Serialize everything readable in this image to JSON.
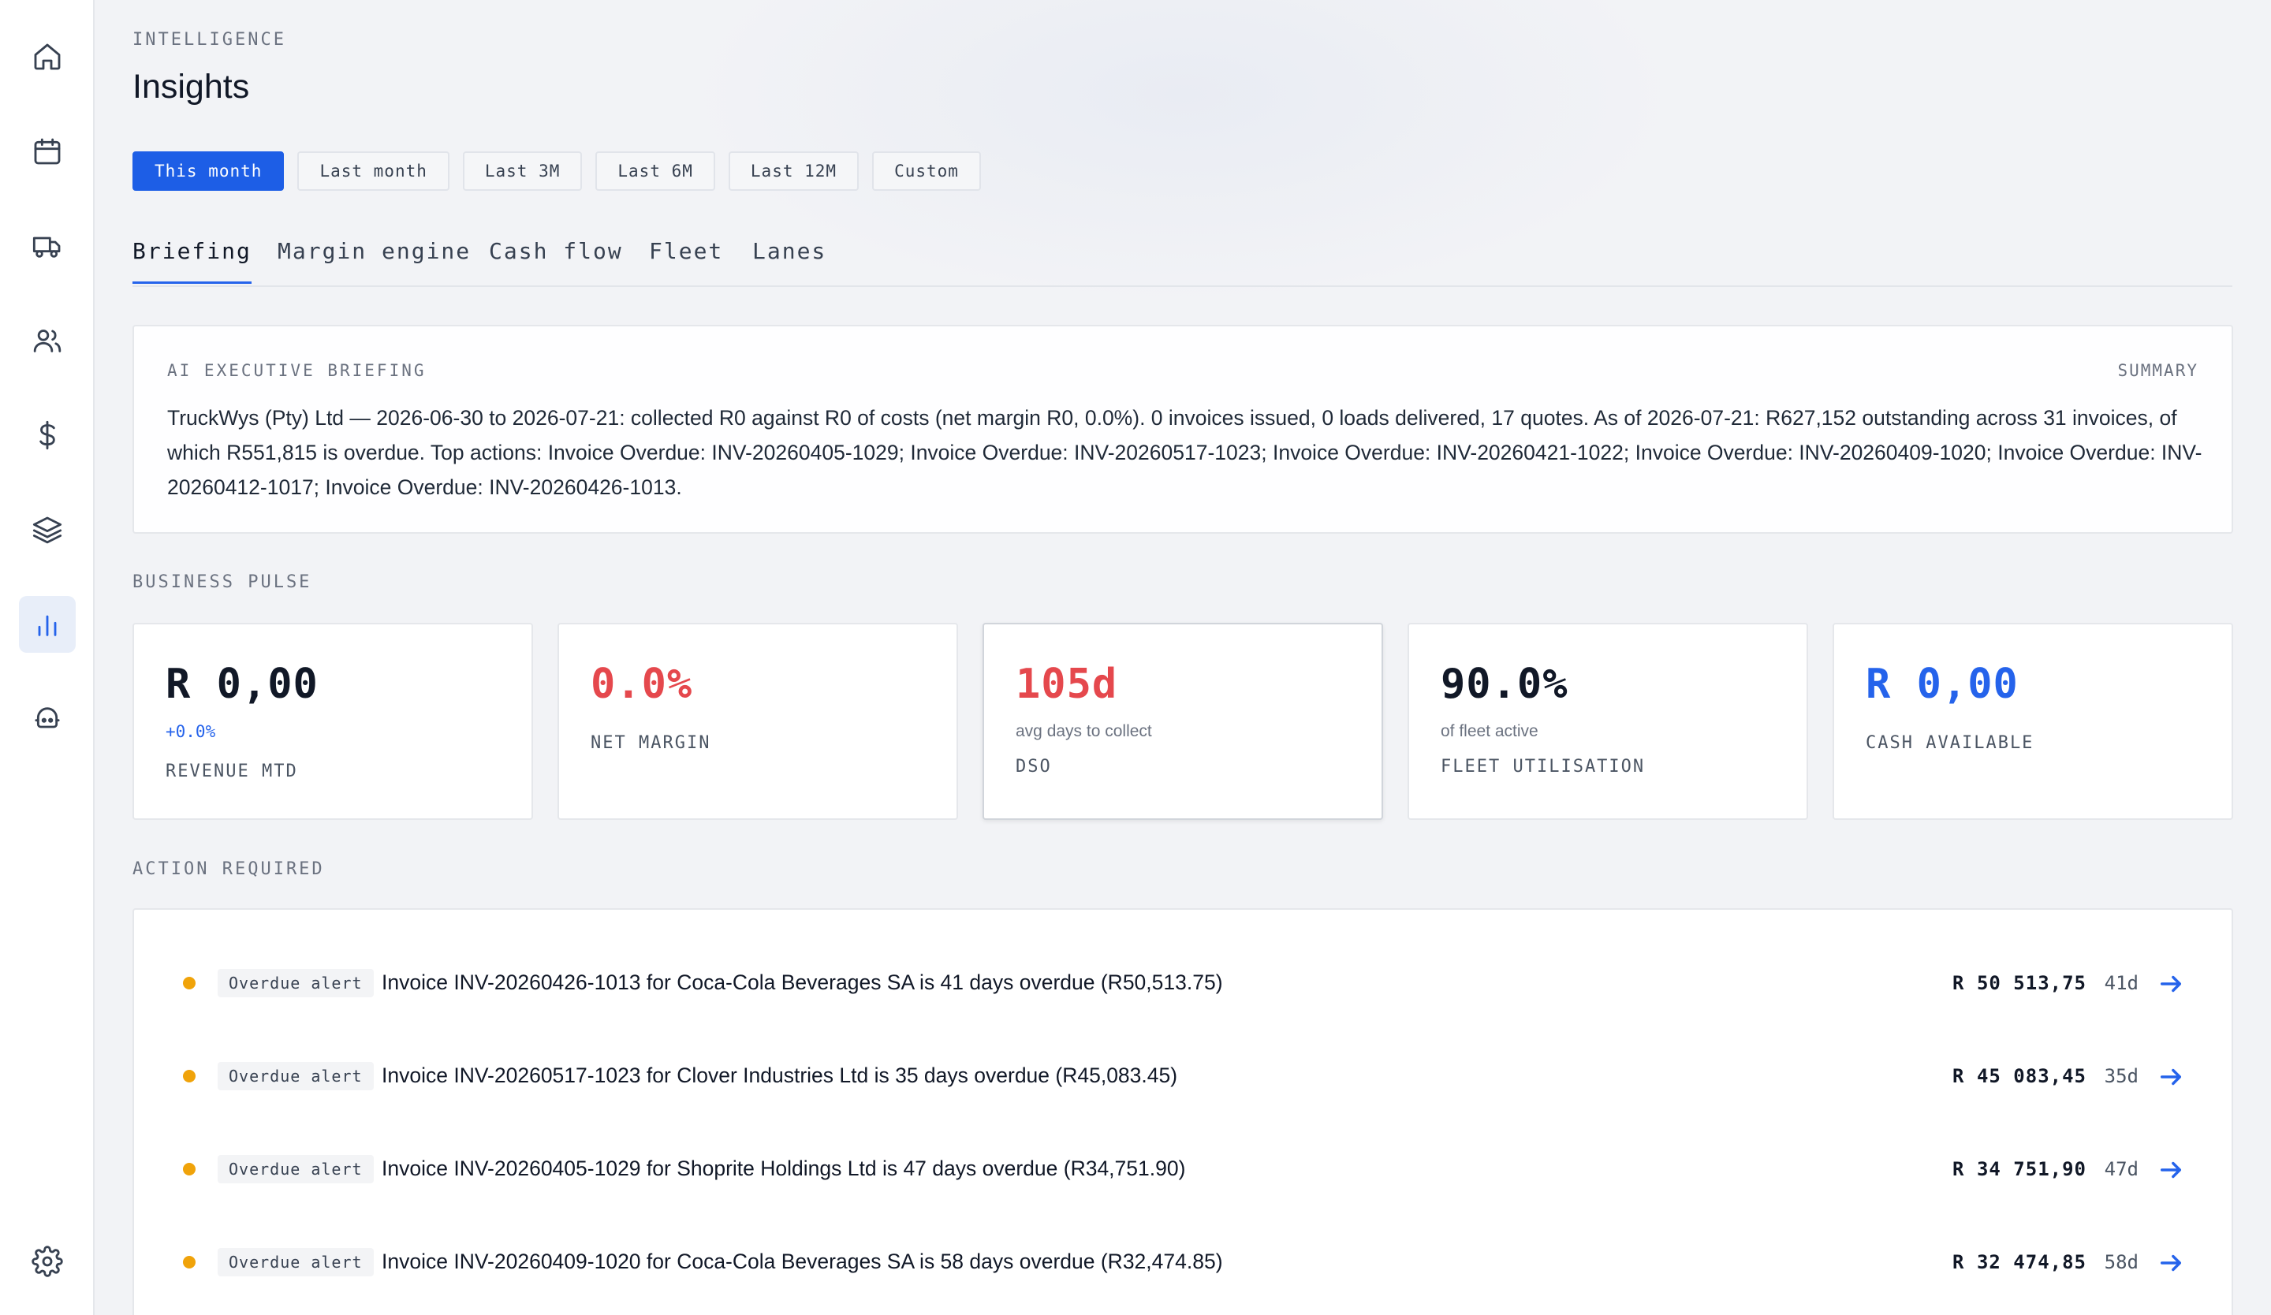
{
  "sidebar": {
    "items": [
      {
        "icon": "home-icon"
      },
      {
        "icon": "calendar-icon"
      },
      {
        "icon": "truck-icon"
      },
      {
        "icon": "users-icon"
      },
      {
        "icon": "dollar-icon"
      },
      {
        "icon": "layers-icon"
      },
      {
        "icon": "bar-chart-icon",
        "active": true
      },
      {
        "icon": "bot-icon"
      },
      {
        "icon": "settings-icon"
      }
    ]
  },
  "header": {
    "eyebrow": "INTELLIGENCE",
    "title": "Insights"
  },
  "date_ranges": [
    "This month",
    "Last month",
    "Last 3M",
    "Last 6M",
    "Last 12M",
    "Custom"
  ],
  "selected_range": "This month",
  "tabs": [
    "Briefing",
    "Margin engine",
    "Cash flow",
    "Fleet",
    "Lanes"
  ],
  "active_tab": "Briefing",
  "briefing": {
    "label": "AI EXECUTIVE BRIEFING",
    "tag": "SUMMARY",
    "text": "TruckWys (Pty) Ltd — 2026-06-30 to 2026-07-21: collected R0 against R0 of costs (net margin R0, 0.0%). 0 invoices issued, 0 loads delivered, 17 quotes. As of 2026-07-21: R627,152 outstanding across 31 invoices, of which R551,815 is overdue. Top actions: Invoice Overdue: INV-20260405-1029; Invoice Overdue: INV-20260517-1023; Invoice Overdue: INV-20260421-1022; Invoice Overdue: INV-20260409-1020; Invoice Overdue: INV-20260412-1017; Invoice Overdue: INV-20260426-1013."
  },
  "pulse": {
    "label": "BUSINESS PULSE",
    "cards": [
      {
        "value": "R 0,00",
        "sub": "+0.0%",
        "label": "REVENUE MTD",
        "color": "#111827",
        "sub_color": "#2563eb"
      },
      {
        "value": "0.0%",
        "sub": "",
        "label": "NET MARGIN",
        "color": "#e5484d"
      },
      {
        "value": "105d",
        "sub": "avg days to collect",
        "label": "DSO",
        "color": "#e5484d"
      },
      {
        "value": "90.0%",
        "sub": "of fleet active",
        "label": "FLEET UTILISATION",
        "color": "#111827"
      },
      {
        "value": "R 0,00",
        "sub": "",
        "label": "CASH AVAILABLE",
        "color": "#2563eb"
      }
    ]
  },
  "actions": {
    "label": "ACTION REQUIRED",
    "items": [
      {
        "badge": "Overdue alert",
        "text": "Invoice INV-20260426-1013 for Coca-Cola Beverages SA is 41 days overdue (R50,513.75)",
        "amount": "R 50 513,75",
        "days": "41d",
        "status_color": "#f0a30a"
      },
      {
        "badge": "Overdue alert",
        "text": "Invoice INV-20260517-1023 for Clover Industries Ltd is 35 days overdue (R45,083.45)",
        "amount": "R 45 083,45",
        "days": "35d",
        "status_color": "#f0a30a"
      },
      {
        "badge": "Overdue alert",
        "text": "Invoice INV-20260405-1029 for Shoprite Holdings Ltd is 47 days overdue (R34,751.90)",
        "amount": "R 34 751,90",
        "days": "47d",
        "status_color": "#f0a30a"
      },
      {
        "badge": "Overdue alert",
        "text": "Invoice INV-20260409-1020 for Coca-Cola Beverages SA is 58 days overdue (R32,474.85)",
        "amount": "R 32 474,85",
        "days": "58d",
        "status_color": "#f0a30a"
      }
    ]
  },
  "colors": {
    "accent": "#2563eb",
    "danger": "#e5484d",
    "warning": "#f0a30a"
  }
}
